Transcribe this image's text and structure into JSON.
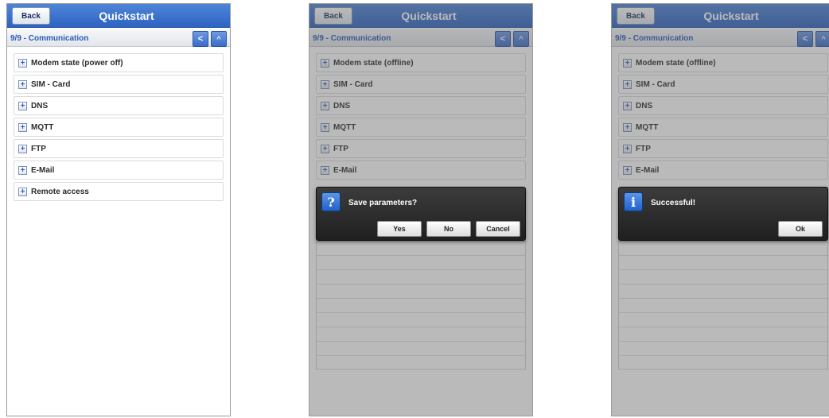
{
  "header": {
    "back_label": "Back",
    "title": "Quickstart",
    "step": "9/9 - Communication",
    "prev_symbol": "<",
    "up_symbol": "^"
  },
  "screens": [
    {
      "items": [
        "Modem state (power off)",
        "SIM - Card",
        "DNS",
        "MQTT",
        "FTP",
        "E-Mail",
        "Remote access"
      ]
    },
    {
      "items": [
        "Modem state (offline)",
        "SIM - Card",
        "DNS",
        "MQTT",
        "FTP",
        "E-Mail"
      ],
      "dialog": {
        "icon": "question-icon",
        "icon_glyph": "?",
        "message": "Save parameters?",
        "buttons": [
          "Yes",
          "No",
          "Cancel"
        ]
      }
    },
    {
      "items": [
        "Modem state (offline)",
        "SIM - Card",
        "DNS",
        "MQTT",
        "FTP",
        "E-Mail"
      ],
      "dialog": {
        "icon": "info-icon",
        "icon_glyph": "i",
        "message": "Successful!",
        "buttons": [
          "Ok"
        ]
      }
    }
  ],
  "colors": {
    "header_blue": "#2d63c2",
    "step_text": "#2a5bb8",
    "dialog_bg": "#2b2b2b"
  },
  "icons": {
    "expand": "plus-icon"
  },
  "plus_glyph": "+"
}
